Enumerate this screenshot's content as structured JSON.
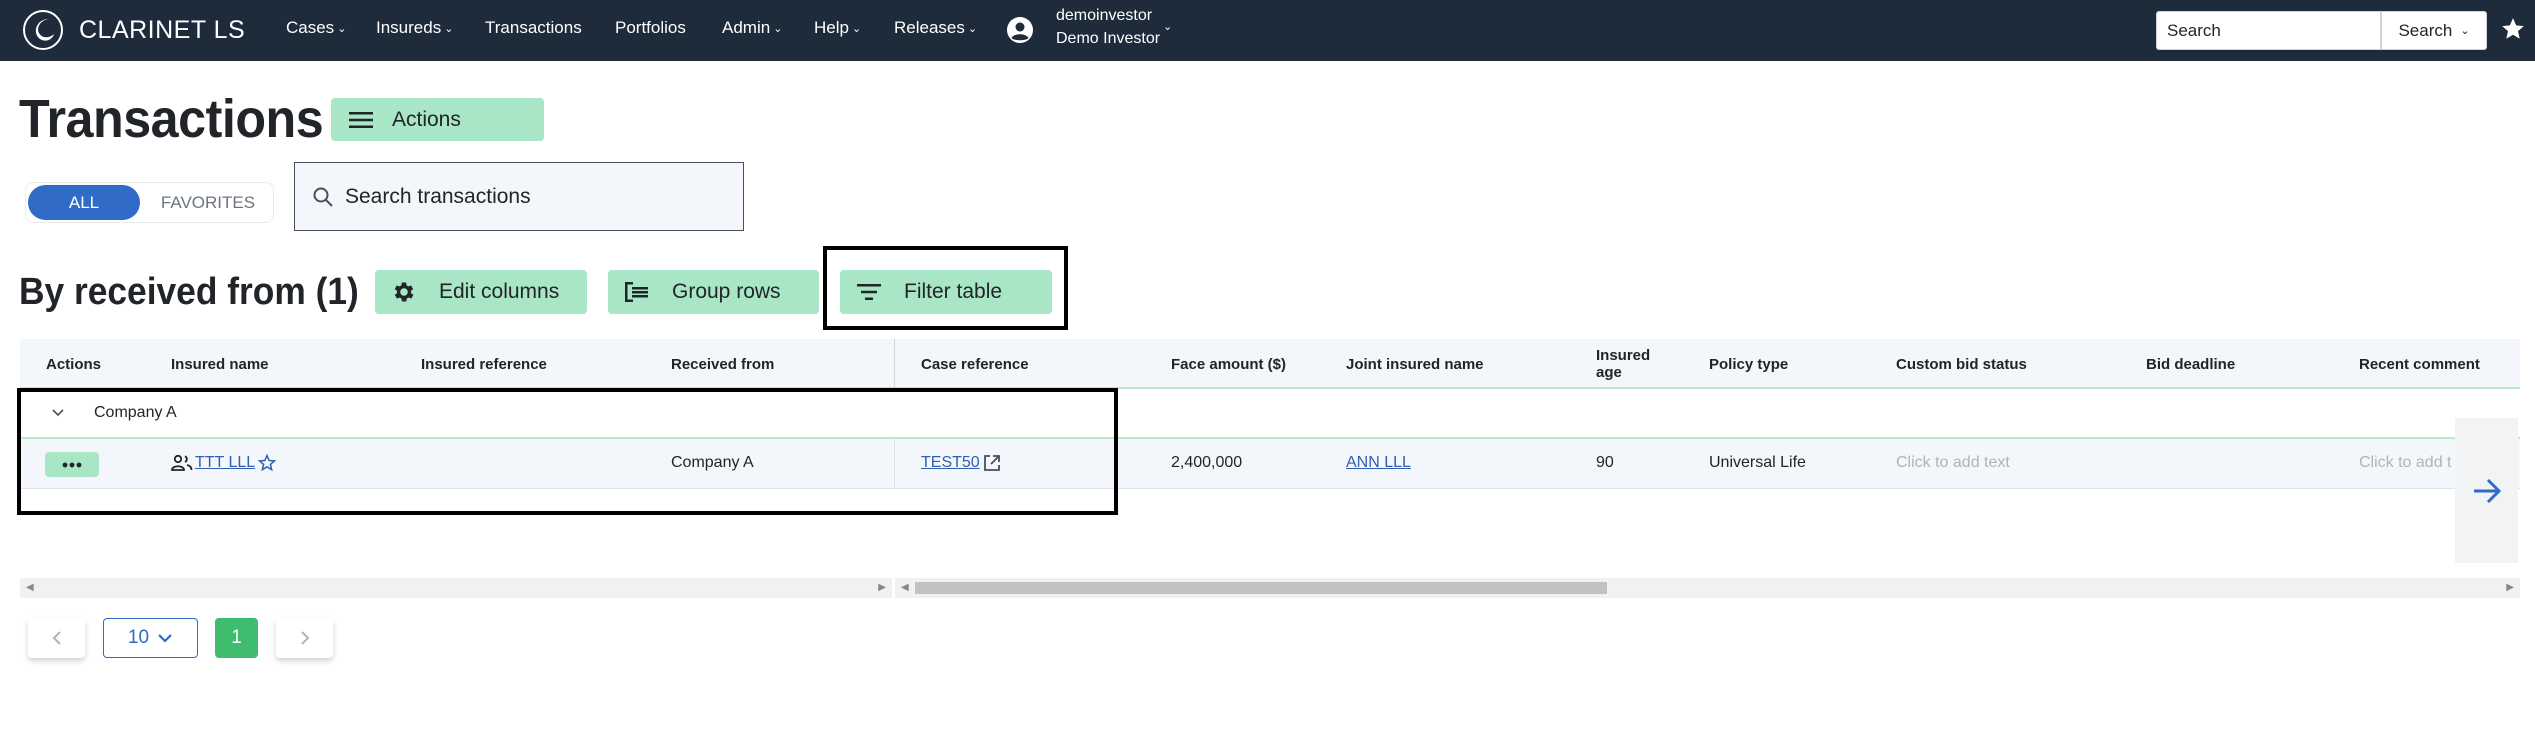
{
  "app": {
    "brand": "CLARINET LS"
  },
  "nav": {
    "items": [
      {
        "label": "Cases",
        "dropdown": true
      },
      {
        "label": "Insureds",
        "dropdown": true
      },
      {
        "label": "Transactions",
        "dropdown": false
      },
      {
        "label": "Portfolios",
        "dropdown": false
      },
      {
        "label": "Admin",
        "dropdown": true
      },
      {
        "label": "Help",
        "dropdown": true
      },
      {
        "label": "Releases",
        "dropdown": true
      }
    ],
    "user": {
      "username": "demoinvestor",
      "display_name": "Demo Investor"
    },
    "search": {
      "placeholder": "Search",
      "button_label": "Search"
    }
  },
  "page": {
    "title": "Transactions",
    "actions_label": "Actions",
    "toggle": {
      "all": "ALL",
      "favorites": "FAVORITES",
      "selected": "ALL"
    },
    "search_placeholder": "Search transactions"
  },
  "section": {
    "title": "By received from (1)",
    "buttons": {
      "edit_columns": "Edit columns",
      "group_rows": "Group rows",
      "filter_table": "Filter table"
    }
  },
  "table": {
    "columns": [
      "Actions",
      "Insured name",
      "Insured reference",
      "Received from",
      "Case reference",
      "Face amount ($)",
      "Joint insured name",
      "Insured age",
      "Policy type",
      "Custom bid status",
      "Bid deadline",
      "Recent comment"
    ],
    "groups": [
      {
        "label": "Company A",
        "rows": [
          {
            "insured_name": "TTT LLL",
            "insured_reference": "",
            "received_from": "Company A",
            "case_reference": "TEST50",
            "face_amount": "2,400,000",
            "joint_insured_name": "ANN LLL",
            "insured_age": "90",
            "policy_type": "Universal Life",
            "custom_bid_status": "Click to add text",
            "bid_deadline": "",
            "recent_comment": "Click to add t"
          }
        ]
      }
    ]
  },
  "pagination": {
    "page_size": "10",
    "current_page": "1"
  },
  "colors": {
    "navbar": "#1d2b3a",
    "accent_green": "#a8e6c5",
    "primary_blue": "#2f6bc7",
    "page_active": "#3ebd6f",
    "link": "#2f5fb0"
  }
}
